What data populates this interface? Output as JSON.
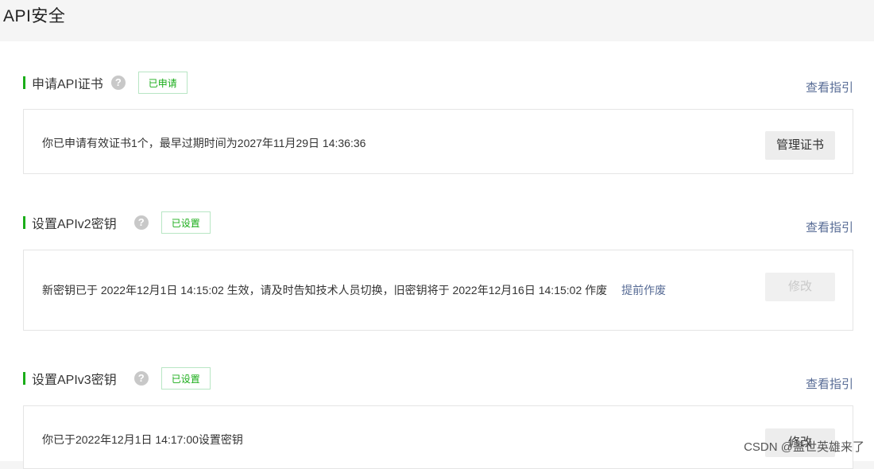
{
  "page": {
    "title": "API安全"
  },
  "sections": [
    {
      "title": "申请API证书",
      "status": "已申请",
      "guide": "查看指引",
      "message": "你已申请有效证书1个，最早过期时间为2027年11月29日 14:36:36",
      "button": "管理证书",
      "button_enabled": true
    },
    {
      "title": "设置APIv2密钥",
      "status": "已设置",
      "guide": "查看指引",
      "message": "新密钥已于 2022年12月1日 14:15:02 生效，请及时告知技术人员切换，旧密钥将于 2022年12月16日 14:15:02 作废",
      "link": "提前作废",
      "button": "修改",
      "button_enabled": false
    },
    {
      "title": "设置APIv3密钥",
      "status": "已设置",
      "guide": "查看指引",
      "message": "你已于2022年12月1日 14:17:00设置密钥",
      "button": "修改",
      "button_enabled": true
    }
  ],
  "icons": {
    "help": "?"
  },
  "watermark": "CSDN @盖世英雄来了",
  "colors": {
    "accent": "#1aad19",
    "link": "#576b95",
    "page_bg": "#f5f5f5"
  }
}
